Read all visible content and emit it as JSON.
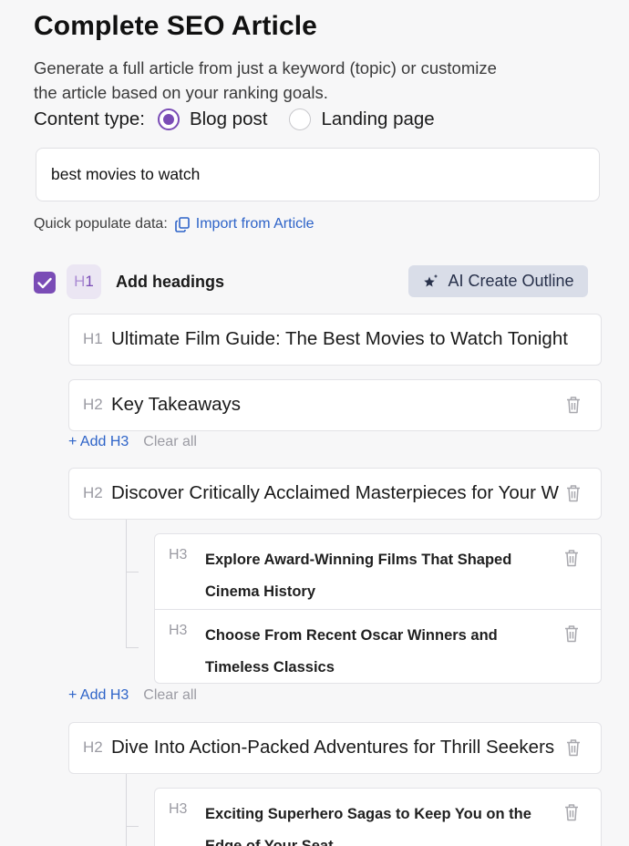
{
  "page": {
    "title": "Complete SEO Article",
    "description": "Generate a full article from just a keyword (topic) or customize the article based on your ranking goals."
  },
  "content_type": {
    "label": "Content type:",
    "options": [
      {
        "label": "Blog post",
        "selected": true
      },
      {
        "label": "Landing page",
        "selected": false
      }
    ]
  },
  "keyword": {
    "value": "best movies to watch"
  },
  "quick_populate": {
    "label": "Quick populate data:",
    "import_label": "Import from Article"
  },
  "headings": {
    "checked": true,
    "chip_prefix": "H",
    "chip_number": "1",
    "label": "Add headings",
    "ai_button": "AI Create Outline",
    "add_h3_label": "+ Add H3",
    "clear_all_label": "Clear all",
    "h1": {
      "tag": "H1",
      "text": "Ultimate Film Guide: The Best Movies to Watch Tonight"
    },
    "sections": [
      {
        "tag": "H2",
        "text": "Key Takeaways",
        "h3": []
      },
      {
        "tag": "H2",
        "text": "Discover Critically Acclaimed Masterpieces for Your Watchlist",
        "h3": [
          {
            "tag": "H3",
            "text": "Explore Award-Winning Films That Shaped Cinema History"
          },
          {
            "tag": "H3",
            "text": "Choose From Recent Oscar Winners and Timeless Classics"
          }
        ]
      },
      {
        "tag": "H2",
        "text": "Dive Into Action-Packed Adventures for Thrill Seekers",
        "h3": [
          {
            "tag": "H3",
            "text": "Exciting Superhero Sagas to Keep You on the Edge of Your Seat"
          }
        ]
      }
    ]
  },
  "colors": {
    "accent": "#7a4cb6",
    "link": "#2d63c8",
    "button_bg": "#d9dde8"
  }
}
